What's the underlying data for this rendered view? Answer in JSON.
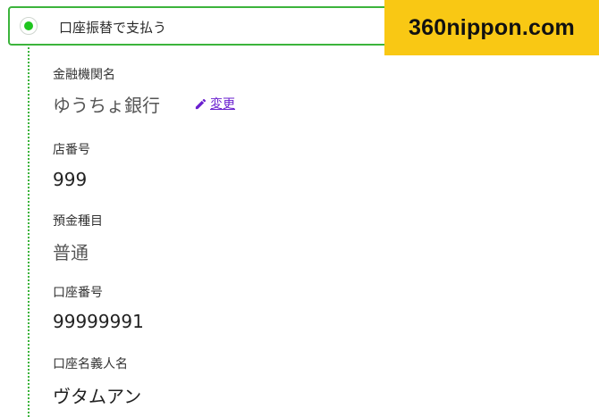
{
  "payment_option": {
    "label": "口座振替で支払う",
    "selected": true,
    "accent_color": "#3cb43c"
  },
  "badge": {
    "text": "360nippon.com",
    "color": "#f9c814"
  },
  "fields": {
    "bank": {
      "label": "金融機関名",
      "value": "ゆうちょ銀行"
    },
    "change_link": {
      "label": "変更",
      "icon": "pencil-icon",
      "color": "#6a1fcf"
    },
    "branch": {
      "label": "店番号",
      "value": "999"
    },
    "account_type": {
      "label": "預金種目",
      "value": "普通"
    },
    "account_number": {
      "label": "口座番号",
      "value": "99999991"
    },
    "account_holder": {
      "label": "口座名義人名",
      "value": "ヴタムアン"
    }
  }
}
